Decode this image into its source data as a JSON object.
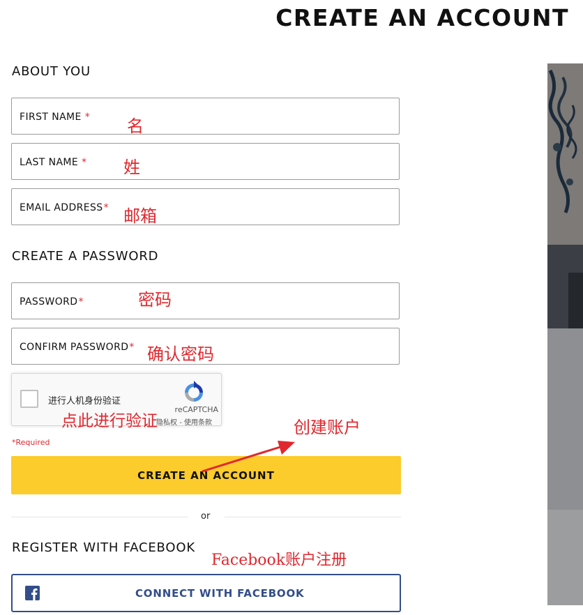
{
  "page": {
    "title": "CREATE AN ACCOUNT"
  },
  "about_you": {
    "heading": "ABOUT YOU",
    "fields": [
      {
        "label": "FIRST NAME",
        "required_mark": "*",
        "annotation": "名"
      },
      {
        "label": "LAST NAME",
        "required_mark": "*",
        "annotation": "姓"
      },
      {
        "label": "EMAIL ADDRESS",
        "required_mark": "*",
        "annotation": "邮箱"
      }
    ]
  },
  "password_section": {
    "heading": "CREATE A PASSWORD",
    "fields": [
      {
        "label": "PASSWORD",
        "required_mark": "*",
        "annotation": "密码"
      },
      {
        "label": "CONFIRM PASSWORD",
        "required_mark": "*",
        "annotation": "确认密码"
      }
    ]
  },
  "recaptcha": {
    "label": "进行人机身份验证",
    "brand": "reCAPTCHA",
    "terms": "隐私权 - 使用条款",
    "annotation": "点此进行验证",
    "checked": false
  },
  "required_note": "*Required",
  "create_button": {
    "label": "CREATE AN ACCOUNT",
    "annotation": "创建账户"
  },
  "divider": {
    "text": "or"
  },
  "facebook": {
    "heading": "REGISTER WITH FACEBOOK",
    "button_label": "CONNECT WITH FACEBOOK",
    "annotation": "Facebook账户注册"
  },
  "colors": {
    "accent_yellow": "#fccb2c",
    "facebook_blue": "#324d8a",
    "required_red": "#e0282e",
    "annotation_red": "#e0282e"
  },
  "icons": [
    "recaptcha-logo-icon",
    "facebook-icon",
    "annotation-arrow-icon"
  ]
}
